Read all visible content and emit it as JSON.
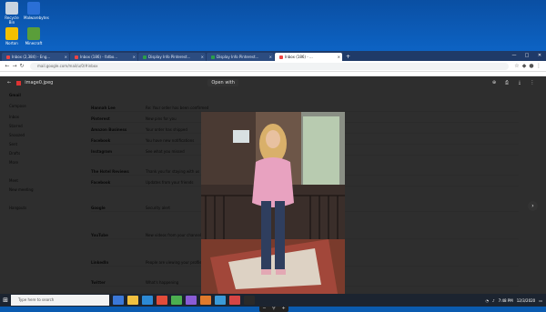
{
  "desktop": {
    "icons": [
      {
        "label": "Recycle Bin",
        "color": "#c9d4e0"
      },
      {
        "label": "Malwarebytes",
        "color": "#2a6fd6"
      },
      {
        "label": "Norton",
        "color": "#f3c000"
      },
      {
        "label": "Minecraft",
        "color": "#5a9e3a"
      }
    ]
  },
  "browser": {
    "tabs": [
      {
        "label": "Inbox (2,384) - Eng..."
      },
      {
        "label": "Inbox (186) - fatbo..."
      },
      {
        "label": "Display Info Pinterest..."
      },
      {
        "label": "Display Info Pinterest..."
      },
      {
        "label": "Inbox (186) - ..."
      }
    ],
    "active_tab_index": 4,
    "address": "mail.google.com/mail/u/0/#inbox",
    "window_buttons": [
      "—",
      "□",
      "✕"
    ]
  },
  "gmail": {
    "brand": "Gmail",
    "compose": "Compose",
    "side": [
      "Inbox",
      "Starred",
      "Snoozed",
      "Sent",
      "Drafts",
      "More",
      "Meet",
      "New meeting",
      "Hangouts"
    ],
    "rows": [
      {
        "from": "Hannah Lee",
        "subject": "Re: Your order has been confirmed",
        "date": "Dec 3"
      },
      {
        "from": "Pinterest",
        "subject": "New pins for you",
        "date": "Dec 3"
      },
      {
        "from": "Amazon Business",
        "subject": "Your order has shipped",
        "date": "Dec 3"
      },
      {
        "from": "Facebook",
        "subject": "You have new notifications",
        "date": "Dec 3"
      },
      {
        "from": "Instagram",
        "subject": "See what you missed",
        "date": "Dec 3"
      },
      {
        "from": "The Hotel Reviews",
        "subject": "Thank you for staying with us",
        "date": "Dec 2"
      },
      {
        "from": "Facebook",
        "subject": "Updates from your friends",
        "date": "Dec 2"
      },
      {
        "from": "Google",
        "subject": "Security alert",
        "date": "Dec 2"
      },
      {
        "from": "YouTube",
        "subject": "New videos from your channels",
        "date": "Dec 2"
      },
      {
        "from": "LinkedIn",
        "subject": "People are viewing your profile",
        "date": "Dec 1"
      },
      {
        "from": "Twitter",
        "subject": "What's happening",
        "date": "Dec 1"
      }
    ]
  },
  "viewer": {
    "filename": "image0.jpeg",
    "open_with": "Open with",
    "next_icon": "›"
  },
  "taskbar": {
    "search_placeholder": "Type here to search",
    "apps": [
      "#3b78d8",
      "#f0c040",
      "#2c8ad6",
      "#e24c3a",
      "#4caf50",
      "#8a5cd6",
      "#e07a2c",
      "#3b9ad8",
      "#d64545",
      "#2a2a2a"
    ],
    "time": "7:48 PM",
    "date": "12/3/2020"
  }
}
